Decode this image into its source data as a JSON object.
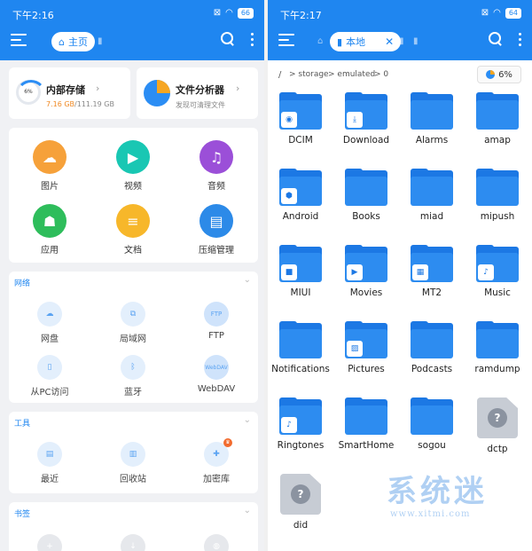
{
  "left": {
    "status": {
      "time": "下午2:16",
      "battery": "66"
    },
    "tab": {
      "label": "主页"
    },
    "storage": {
      "title": "内部存储",
      "percent": "6%",
      "used": "7.16 GB",
      "total": "/111.19 GB",
      "fill_fraction": 0.06
    },
    "analyzer": {
      "title": "文件分析器",
      "subtitle": "发现可清理文件"
    },
    "categories": [
      {
        "label": "图片",
        "icon": "image-icon",
        "color": "#f6a13a"
      },
      {
        "label": "视频",
        "icon": "video-icon",
        "color": "#19c7b3"
      },
      {
        "label": "音频",
        "icon": "music-icon",
        "color": "#9b4fd8"
      },
      {
        "label": "应用",
        "icon": "android-icon",
        "color": "#2ebd5b"
      },
      {
        "label": "文档",
        "icon": "document-icon",
        "color": "#f7b72a"
      },
      {
        "label": "压缩管理",
        "icon": "archive-icon",
        "color": "#2c8ae8"
      }
    ],
    "network": {
      "title": "网络",
      "items": [
        {
          "label": "网盘",
          "icon": "cloud-icon"
        },
        {
          "label": "局域网",
          "icon": "lan-icon"
        },
        {
          "label": "FTP",
          "icon": "ftp-icon",
          "glyph": "FTP"
        },
        {
          "label": "从PC访问",
          "icon": "pc-access-icon"
        },
        {
          "label": "蓝牙",
          "icon": "bluetooth-icon"
        },
        {
          "label": "WebDAV",
          "icon": "webdav-icon",
          "glyph": "WebDAV"
        }
      ]
    },
    "tools": {
      "title": "工具",
      "items": [
        {
          "label": "最近",
          "icon": "recent-icon"
        },
        {
          "label": "回收站",
          "icon": "recycle-bin-icon"
        },
        {
          "label": "加密库",
          "icon": "vault-icon"
        }
      ]
    },
    "bookmarks": {
      "title": "书签"
    }
  },
  "right": {
    "status": {
      "time": "下午2:17",
      "battery": "64"
    },
    "tab": {
      "label": "本地"
    },
    "path": {
      "root": "/",
      "seg1": "> storage",
      "seg2": "> emulated",
      "seg3": "> 0",
      "usage": "6%"
    },
    "files": [
      {
        "name": "DCIM",
        "type": "folder",
        "badge": "camera"
      },
      {
        "name": "Download",
        "type": "folder",
        "badge": "download"
      },
      {
        "name": "Alarms",
        "type": "folder"
      },
      {
        "name": "amap",
        "type": "folder"
      },
      {
        "name": "Android",
        "type": "folder",
        "badge": "android"
      },
      {
        "name": "Books",
        "type": "folder"
      },
      {
        "name": "miad",
        "type": "folder"
      },
      {
        "name": "mipush",
        "type": "folder"
      },
      {
        "name": "MIUI",
        "type": "folder",
        "badge": "miui"
      },
      {
        "name": "Movies",
        "type": "folder",
        "badge": "play"
      },
      {
        "name": "MT2",
        "type": "folder",
        "badge": "mt2"
      },
      {
        "name": "Music",
        "type": "folder",
        "badge": "note"
      },
      {
        "name": "Notifications",
        "type": "folder"
      },
      {
        "name": "Pictures",
        "type": "folder",
        "badge": "picture"
      },
      {
        "name": "Podcasts",
        "type": "folder"
      },
      {
        "name": "ramdump",
        "type": "folder"
      },
      {
        "name": "Ringtones",
        "type": "folder",
        "badge": "note"
      },
      {
        "name": "SmartHome",
        "type": "folder"
      },
      {
        "name": "sogou",
        "type": "folder"
      },
      {
        "name": "dctp",
        "type": "unknown"
      },
      {
        "name": "did",
        "type": "unknown"
      }
    ]
  },
  "watermark": {
    "cn": "系统迷",
    "url": "www.xitmi.com"
  },
  "colors": {
    "primary": "#1f86f0",
    "folder": "#2d8cf0",
    "storage_used": "#f08a24"
  }
}
